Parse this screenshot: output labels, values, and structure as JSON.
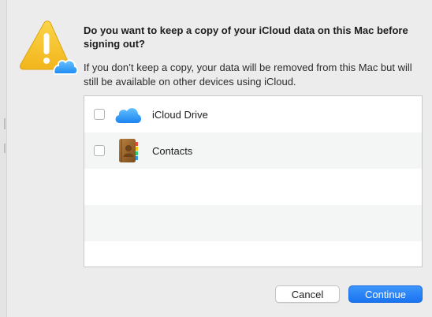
{
  "dialog": {
    "title": "Do you want to keep a copy of your iCloud data on this Mac before signing out?",
    "message": "If you don’t keep a copy, your data will be removed from this Mac but will still be available on other devices using iCloud.",
    "alert_icon": "warning-triangle-with-icloud-badge",
    "accent_color": "#1a74f0",
    "warning_color": "#f6c325"
  },
  "list": {
    "items": [
      {
        "label": "iCloud Drive",
        "icon": "icloud-drive-icon",
        "checked": false
      },
      {
        "label": "Contacts",
        "icon": "contacts-icon",
        "checked": false
      }
    ]
  },
  "buttons": {
    "cancel_label": "Cancel",
    "continue_label": "Continue"
  }
}
